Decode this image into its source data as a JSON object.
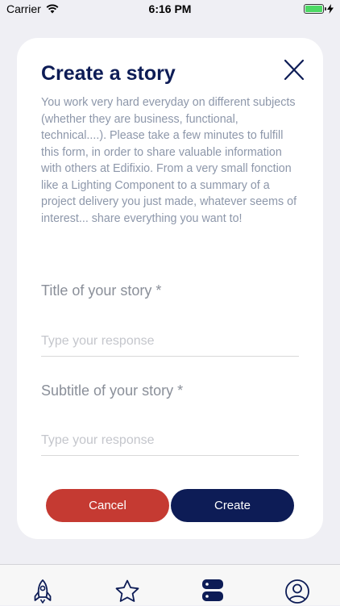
{
  "status_bar": {
    "carrier": "Carrier",
    "time": "6:16 PM",
    "battery_level": 1.0
  },
  "dialog": {
    "title": "Create a story",
    "description": "You work very hard everyday on different subjects (whether they are business, functional, technical....). Please take a few minutes to fulfill this form, in order to share valuable information with others at Edifixio. From a very small fonction like a Lighting Component to a summary of a project delivery you just made, whatever seems of interest... share everything you want to!",
    "fields": [
      {
        "label": "Title of your story *",
        "placeholder": "Type your response",
        "value": ""
      },
      {
        "label": "Subtitle of your story *",
        "placeholder": "Type your response",
        "value": ""
      }
    ],
    "cancel_label": "Cancel",
    "create_label": "Create"
  },
  "tab_bar": {
    "tabs": [
      {
        "icon": "rocket-icon",
        "active": false
      },
      {
        "icon": "star-icon",
        "active": false
      },
      {
        "icon": "stack-icon",
        "active": true
      },
      {
        "icon": "user-icon",
        "active": false
      }
    ]
  },
  "colors": {
    "primary": "#0d1c56",
    "danger": "#c53a32",
    "background": "#efeff4",
    "card": "#ffffff",
    "muted_text": "#8d97aa"
  }
}
